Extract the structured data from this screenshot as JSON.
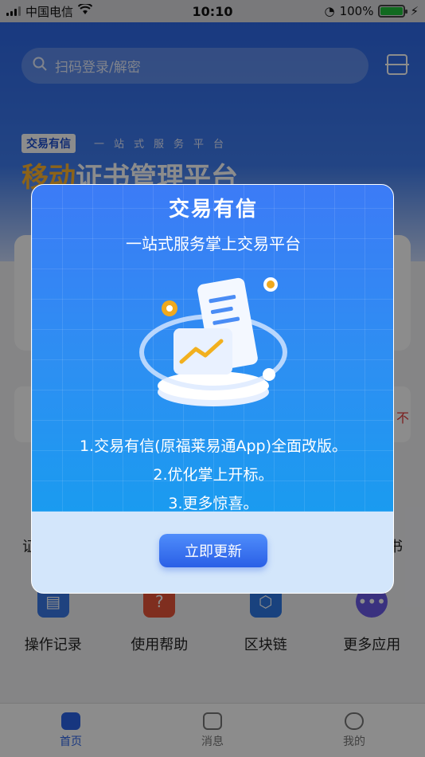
{
  "status_bar": {
    "carrier": "中国电信",
    "time": "10:10",
    "battery": "100%"
  },
  "search": {
    "placeholder": "扫码登录/解密"
  },
  "banner": {
    "tag": "交易有信",
    "slogan": "一站式服务平台",
    "title_highlight": "移动",
    "title_rest": "证书管理平台"
  },
  "notice": {
    "text": "不"
  },
  "side_labels": {
    "left": "证",
    "right": "书"
  },
  "apps": [
    {
      "label": "操作记录",
      "icon": "record-icon"
    },
    {
      "label": "使用帮助",
      "icon": "help-icon"
    },
    {
      "label": "区块链",
      "icon": "blockchain-icon"
    },
    {
      "label": "更多应用",
      "icon": "more-icon"
    }
  ],
  "tabbar": [
    {
      "label": "首页",
      "icon": "home-icon",
      "active": true
    },
    {
      "label": "消息",
      "icon": "message-icon",
      "active": false
    },
    {
      "label": "我的",
      "icon": "profile-icon",
      "active": false
    }
  ],
  "modal": {
    "title": "交易有信",
    "subtitle": "一站式服务掌上交易平台",
    "lines": [
      "1.交易有信(原福莱易通App)全面改版。",
      "2.优化掌上开标。",
      "3.更多惊喜。"
    ],
    "button": "立即更新"
  },
  "colors": {
    "accent": "#2a63e8",
    "highlight": "#ffb52e"
  }
}
